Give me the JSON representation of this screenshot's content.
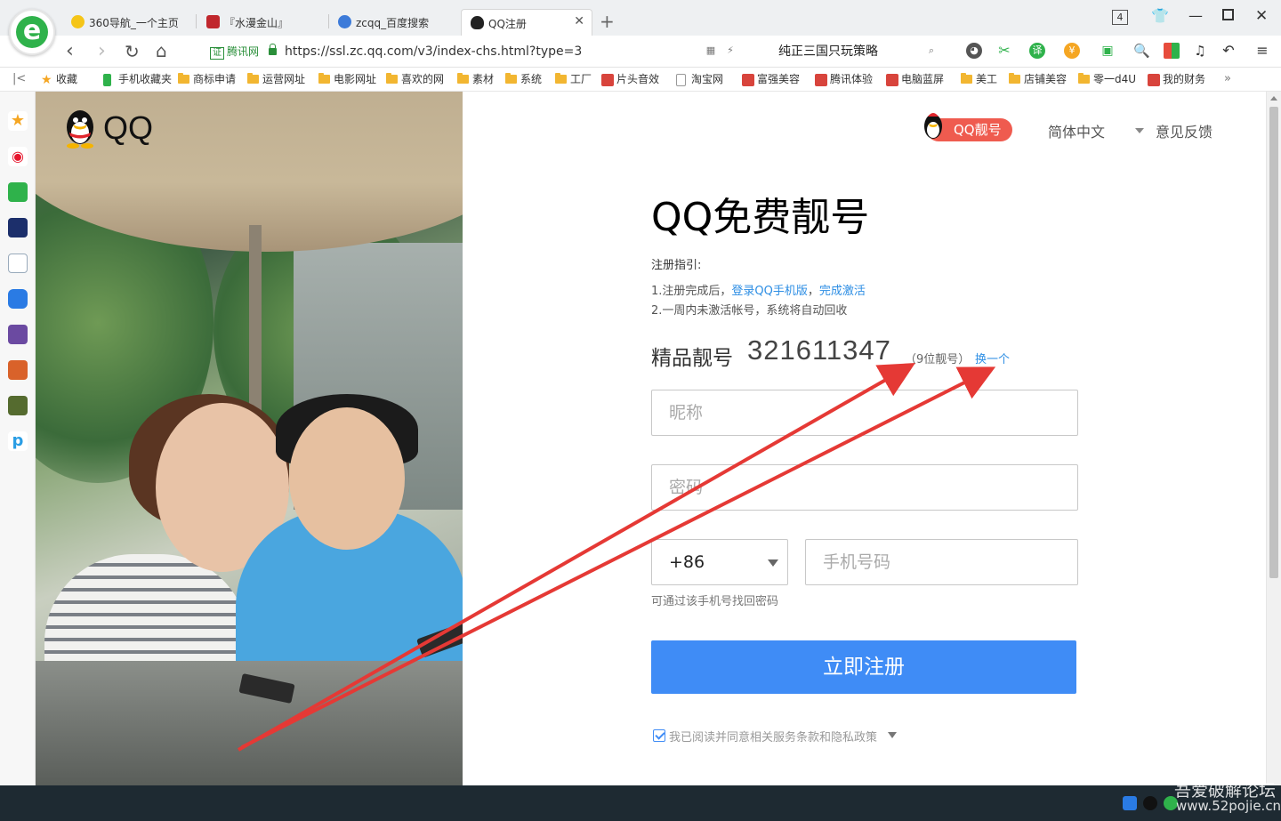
{
  "browser": {
    "tabs": [
      {
        "label": "360导航_一个主页",
        "active": false
      },
      {
        "label": "『水漫金山』",
        "active": false
      },
      {
        "label": "zcqq_百度搜索",
        "active": false
      },
      {
        "label": "QQ注册",
        "active": true
      }
    ],
    "tab_count": "4",
    "cert_badge": "证",
    "cert_label": "腾讯网",
    "url": "https://ssl.zc.qq.com/v3/index-chs.html?type=3",
    "search_text": "纯正三国只玩策略"
  },
  "bookmarks": [
    {
      "label": "收藏",
      "kind": "star"
    },
    {
      "label": "手机收藏夹",
      "kind": "phone"
    },
    {
      "label": "商标申请",
      "kind": "folder"
    },
    {
      "label": "运营网址",
      "kind": "folder"
    },
    {
      "label": "电影网址",
      "kind": "folder"
    },
    {
      "label": "喜欢的网",
      "kind": "folder"
    },
    {
      "label": "素材",
      "kind": "folder"
    },
    {
      "label": "系统",
      "kind": "folder"
    },
    {
      "label": "工厂",
      "kind": "folder"
    },
    {
      "label": "片头音效",
      "kind": "site"
    },
    {
      "label": "淘宝网",
      "kind": "page"
    },
    {
      "label": "富强美容",
      "kind": "site"
    },
    {
      "label": "腾讯体验",
      "kind": "site"
    },
    {
      "label": "电脑蓝屏",
      "kind": "site"
    },
    {
      "label": "美工",
      "kind": "folder"
    },
    {
      "label": "店铺美容",
      "kind": "folder"
    },
    {
      "label": "零一d4U",
      "kind": "folder"
    },
    {
      "label": "我的财务",
      "kind": "site"
    }
  ],
  "brand": {
    "logo_text": "QQ"
  },
  "header": {
    "badge_label": "QQ靓号",
    "language": "简体中文",
    "feedback": "意见反馈"
  },
  "form": {
    "title": "QQ免费靓号",
    "guide_heading": "注册指引:",
    "guide_line1_prefix": "1.注册完成后，",
    "guide_link1": "登录QQ手机版",
    "guide_sep": "，",
    "guide_link2": "完成激活",
    "guide_line2": "2.一周内未激活帐号，系统将自动回收",
    "number_label": "精品靓号",
    "number_value": "321611347",
    "number_note": "（9位靓号）",
    "number_change": "换一个",
    "nickname_placeholder": "昵称",
    "password_placeholder": "密码",
    "country_code": "+86",
    "phone_placeholder": "手机号码",
    "phone_hint": "可通过该手机号找回密码",
    "submit_label": "立即注册",
    "agree_text": "我已阅读并同意相关服务条款和隐私政策",
    "agree_checked": true
  },
  "watermark": {
    "line1": "吾爱破解论坛",
    "line2": "www.52pojie.cn"
  },
  "colors": {
    "accent": "#3f8cf6",
    "link": "#2d8ee4",
    "badge": "#ef5b4f",
    "annotation": "#e53935"
  }
}
